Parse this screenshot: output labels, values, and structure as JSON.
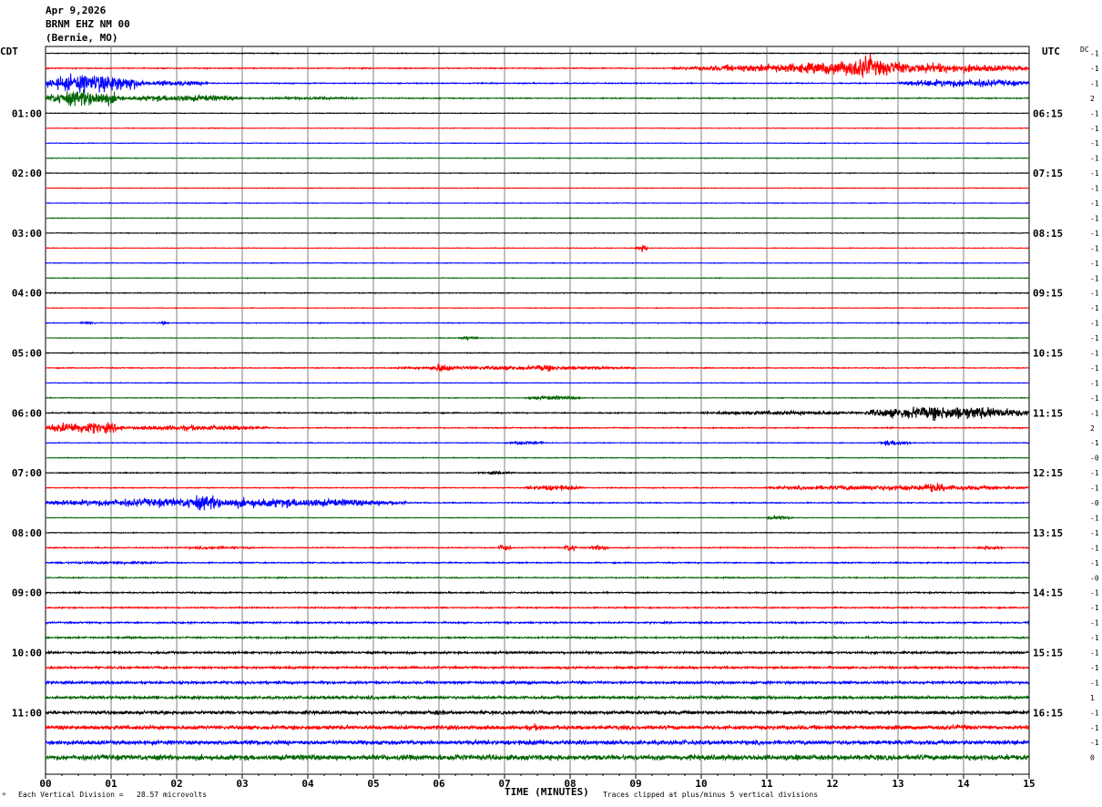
{
  "header": {
    "date": "Apr 9,2026",
    "station": "BRNM EHZ NM 00",
    "location": "(Bernie, MO)"
  },
  "left_axis_label": "CDT",
  "right_axis_label": "UTC",
  "dc_label": "DC",
  "footer": {
    "vertical_division": "Each Vertical Division =   28.57 microvolts",
    "xlabel": "TIME (MINUTES)",
    "clip_note": "Traces clipped at plus/minus 5 vertical divisions"
  },
  "chart_data": {
    "type": "line",
    "title": "BRNM EHZ NM 00",
    "xlabel": "TIME (MINUTES)",
    "xlim": [
      0,
      15
    ],
    "x_ticks": [
      "00",
      "01",
      "02",
      "03",
      "04",
      "05",
      "06",
      "07",
      "08",
      "09",
      "10",
      "11",
      "12",
      "13",
      "14",
      "15"
    ],
    "grid": true,
    "trace_colors": [
      "#000000",
      "#ff0000",
      "#0000ff",
      "#006400"
    ],
    "left_hour_labels": [
      "01:00",
      "02:00",
      "03:00",
      "04:00",
      "05:00",
      "06:00",
      "07:00",
      "08:00",
      "09:00",
      "10:00",
      "11:00"
    ],
    "right_hour_labels": [
      "06:15",
      "07:15",
      "08:15",
      "09:15",
      "10:15",
      "11:15",
      "12:15",
      "13:15",
      "14:15",
      "15:15",
      "16:15"
    ],
    "dc_offsets": [
      "-1",
      "-1",
      "-1",
      "2",
      "-1",
      "-1",
      "-1",
      "-1",
      "-1",
      "-1",
      "-1",
      "-1",
      "-1",
      "-1",
      "-1",
      "-1",
      "-1",
      "-1",
      "-1",
      "-1",
      "-1",
      "-1",
      "-1",
      "-1",
      "-1",
      "2",
      "-1",
      "-0",
      "-1",
      "-1",
      "-0",
      "-1",
      "-1",
      "-1",
      "-1",
      "-0",
      "-1",
      "-1",
      "-1",
      "-1",
      "-1",
      "-1",
      "-1",
      "1",
      "-1",
      "-1",
      "-1",
      "0"
    ],
    "traces": [
      {
        "row": 0,
        "amp": 0.6,
        "events": []
      },
      {
        "row": 1,
        "amp": 0.8,
        "events": [
          {
            "t": 9.5,
            "t2": 11,
            "a": 3
          },
          {
            "t": 10,
            "t2": 15,
            "a": 8
          },
          {
            "t": 11.5,
            "t2": 13.5,
            "a": 12
          },
          {
            "t": 12.3,
            "t2": 12.7,
            "a": 20
          }
        ]
      },
      {
        "row": 2,
        "amp": 0.8,
        "events": [
          {
            "t": 0,
            "t2": 1.5,
            "a": 14
          },
          {
            "t": 1.5,
            "t2": 2.5,
            "a": 4
          },
          {
            "t": 13,
            "t2": 15,
            "a": 6
          }
        ]
      },
      {
        "row": 3,
        "amp": 0.8,
        "events": [
          {
            "t": 0,
            "t2": 1.2,
            "a": 12
          },
          {
            "t": 1.2,
            "t2": 3,
            "a": 5
          },
          {
            "t": 3,
            "t2": 5,
            "a": 2
          }
        ]
      },
      {
        "row": 4,
        "amp": 0.5,
        "events": []
      },
      {
        "row": 5,
        "amp": 0.5,
        "events": []
      },
      {
        "row": 6,
        "amp": 0.5,
        "events": []
      },
      {
        "row": 7,
        "amp": 0.5,
        "events": []
      },
      {
        "row": 8,
        "amp": 0.5,
        "events": []
      },
      {
        "row": 9,
        "amp": 0.5,
        "events": []
      },
      {
        "row": 10,
        "amp": 0.5,
        "events": []
      },
      {
        "row": 11,
        "amp": 0.5,
        "events": []
      },
      {
        "row": 12,
        "amp": 0.5,
        "events": []
      },
      {
        "row": 13,
        "amp": 0.5,
        "events": [
          {
            "t": 9.0,
            "t2": 9.2,
            "a": 5
          }
        ]
      },
      {
        "row": 14,
        "amp": 0.5,
        "events": []
      },
      {
        "row": 15,
        "amp": 0.5,
        "events": []
      },
      {
        "row": 16,
        "amp": 0.6,
        "events": []
      },
      {
        "row": 17,
        "amp": 0.5,
        "events": []
      },
      {
        "row": 18,
        "amp": 0.6,
        "events": [
          {
            "t": 0.5,
            "t2": 0.8,
            "a": 2
          },
          {
            "t": 1.7,
            "t2": 1.9,
            "a": 2
          }
        ]
      },
      {
        "row": 19,
        "amp": 0.5,
        "events": [
          {
            "t": 6.3,
            "t2": 6.6,
            "a": 3
          }
        ]
      },
      {
        "row": 20,
        "amp": 0.6,
        "events": []
      },
      {
        "row": 21,
        "amp": 0.7,
        "events": [
          {
            "t": 5.3,
            "t2": 9,
            "a": 3
          },
          {
            "t": 5.9,
            "t2": 6.2,
            "a": 7
          },
          {
            "t": 7.4,
            "t2": 7.8,
            "a": 5
          }
        ]
      },
      {
        "row": 22,
        "amp": 0.5,
        "events": []
      },
      {
        "row": 23,
        "amp": 0.6,
        "events": [
          {
            "t": 7.3,
            "t2": 8.2,
            "a": 3
          }
        ]
      },
      {
        "row": 24,
        "amp": 0.8,
        "events": [
          {
            "t": 10,
            "t2": 12.5,
            "a": 3
          },
          {
            "t": 12.5,
            "t2": 15,
            "a": 10
          }
        ]
      },
      {
        "row": 25,
        "amp": 0.8,
        "events": [
          {
            "t": 0,
            "t2": 1.2,
            "a": 9
          },
          {
            "t": 1.2,
            "t2": 3.4,
            "a": 4
          }
        ]
      },
      {
        "row": 26,
        "amp": 0.6,
        "events": [
          {
            "t": 7,
            "t2": 7.6,
            "a": 3
          },
          {
            "t": 12.7,
            "t2": 13.2,
            "a": 4
          }
        ]
      },
      {
        "row": 27,
        "amp": 0.6,
        "events": []
      },
      {
        "row": 28,
        "amp": 0.7,
        "events": [
          {
            "t": 6.6,
            "t2": 7.2,
            "a": 2
          }
        ]
      },
      {
        "row": 29,
        "amp": 0.7,
        "events": [
          {
            "t": 7.3,
            "t2": 8.2,
            "a": 4
          },
          {
            "t": 11,
            "t2": 15,
            "a": 4
          },
          {
            "t": 13.3,
            "t2": 13.8,
            "a": 7
          }
        ]
      },
      {
        "row": 30,
        "amp": 0.8,
        "events": [
          {
            "t": 0,
            "t2": 5.5,
            "a": 7
          },
          {
            "t": 2,
            "t2": 2.8,
            "a": 11
          }
        ]
      },
      {
        "row": 31,
        "amp": 0.5,
        "events": [
          {
            "t": 11,
            "t2": 11.4,
            "a": 3
          }
        ]
      },
      {
        "row": 32,
        "amp": 0.6,
        "events": []
      },
      {
        "row": 33,
        "amp": 0.8,
        "events": [
          {
            "t": 2,
            "t2": 3.2,
            "a": 2
          },
          {
            "t": 6.9,
            "t2": 7.1,
            "a": 6
          },
          {
            "t": 7.9,
            "t2": 8.1,
            "a": 6
          },
          {
            "t": 8.3,
            "t2": 8.6,
            "a": 4
          },
          {
            "t": 14.2,
            "t2": 14.6,
            "a": 3
          }
        ]
      },
      {
        "row": 34,
        "amp": 0.9,
        "events": [
          {
            "t": 0,
            "t2": 2,
            "a": 2
          }
        ]
      },
      {
        "row": 35,
        "amp": 0.8,
        "events": []
      },
      {
        "row": 36,
        "amp": 1.0,
        "events": []
      },
      {
        "row": 37,
        "amp": 1.0,
        "events": []
      },
      {
        "row": 38,
        "amp": 1.2,
        "events": [
          {
            "t": 4.8,
            "t2": 5.2,
            "a": 2
          }
        ]
      },
      {
        "row": 39,
        "amp": 1.2,
        "events": []
      },
      {
        "row": 40,
        "amp": 1.6,
        "events": []
      },
      {
        "row": 41,
        "amp": 1.6,
        "events": []
      },
      {
        "row": 42,
        "amp": 2.0,
        "events": []
      },
      {
        "row": 43,
        "amp": 2.2,
        "events": [
          {
            "t": 4.2,
            "t2": 4.5,
            "a": 3
          }
        ]
      },
      {
        "row": 44,
        "amp": 2.5,
        "events": [
          {
            "t": 5.8,
            "t2": 6.2,
            "a": 4
          }
        ]
      },
      {
        "row": 45,
        "amp": 3.0,
        "events": [
          {
            "t": 7.3,
            "t2": 7.7,
            "a": 5
          },
          {
            "t": 13.5,
            "t2": 14.2,
            "a": 4
          }
        ]
      },
      {
        "row": 46,
        "amp": 3.2,
        "events": [
          {
            "t": 7,
            "t2": 8,
            "a": 4
          }
        ]
      },
      {
        "row": 47,
        "amp": 4.0,
        "events": [
          {
            "t": 6,
            "t2": 6.5,
            "a": 6
          }
        ]
      }
    ]
  }
}
